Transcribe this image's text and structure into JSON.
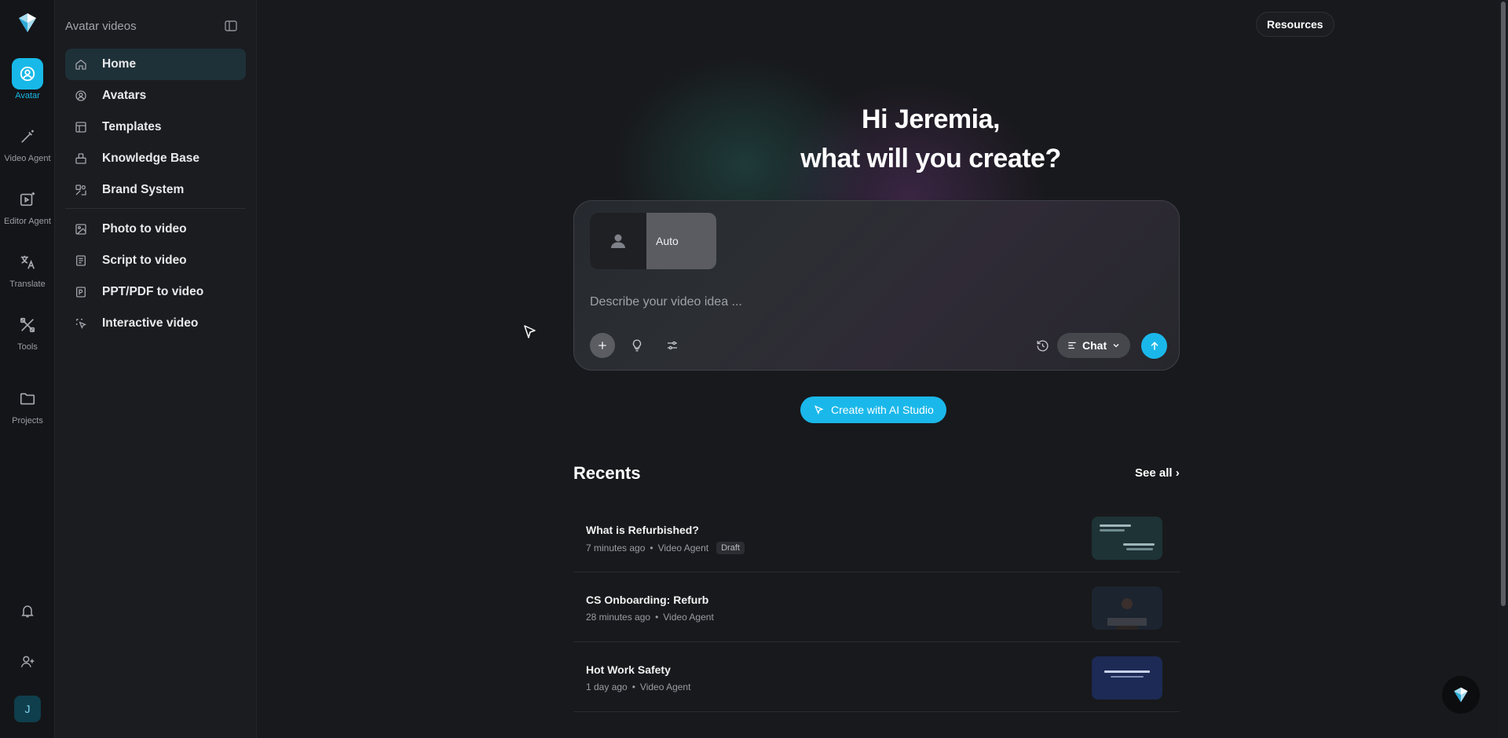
{
  "rail": {
    "items": [
      {
        "label": "Avatar",
        "icon": "avatar-icon",
        "active": true
      },
      {
        "label": "Video Agent",
        "icon": "magic-wand-icon"
      },
      {
        "label": "Editor Agent",
        "icon": "video-edit-icon"
      },
      {
        "label": "Translate",
        "icon": "translate-icon"
      },
      {
        "label": "Tools",
        "icon": "tools-icon"
      },
      {
        "label": "Projects",
        "icon": "folder-icon"
      }
    ],
    "user_initial": "J"
  },
  "sidebar": {
    "title": "Avatar videos",
    "primary": [
      {
        "label": "Home",
        "icon": "home-icon",
        "active": true
      },
      {
        "label": "Avatars",
        "icon": "avatar-icon"
      },
      {
        "label": "Templates",
        "icon": "templates-icon"
      },
      {
        "label": "Knowledge Base",
        "icon": "knowledge-icon"
      },
      {
        "label": "Brand System",
        "icon": "brand-icon"
      }
    ],
    "secondary": [
      {
        "label": "Photo to video",
        "icon": "photo-icon"
      },
      {
        "label": "Script to video",
        "icon": "script-icon"
      },
      {
        "label": "PPT/PDF to video",
        "icon": "ppt-icon"
      },
      {
        "label": "Interactive video",
        "icon": "interactive-icon"
      }
    ]
  },
  "header": {
    "resources_label": "Resources"
  },
  "hero": {
    "line1": "Hi Jeremia,",
    "line2": "what will you create?"
  },
  "prompt": {
    "avatar_label": "Auto",
    "placeholder": "Describe your video idea ...",
    "mode_label": "Chat"
  },
  "studio_button": "Create with AI Studio",
  "recents": {
    "title": "Recents",
    "see_all": "See all ›",
    "items": [
      {
        "title": "What is Refurbished?",
        "time": "7 minutes ago",
        "source": "Video Agent",
        "badge": "Draft"
      },
      {
        "title": "CS Onboarding: Refurb",
        "time": "28 minutes ago",
        "source": "Video Agent",
        "badge": ""
      },
      {
        "title": "Hot Work Safety",
        "time": "1 day ago",
        "source": "Video Agent",
        "badge": ""
      }
    ]
  },
  "colors": {
    "accent": "#1ab8ea",
    "background": "#18191c",
    "sidebar": "#1b1c20"
  }
}
